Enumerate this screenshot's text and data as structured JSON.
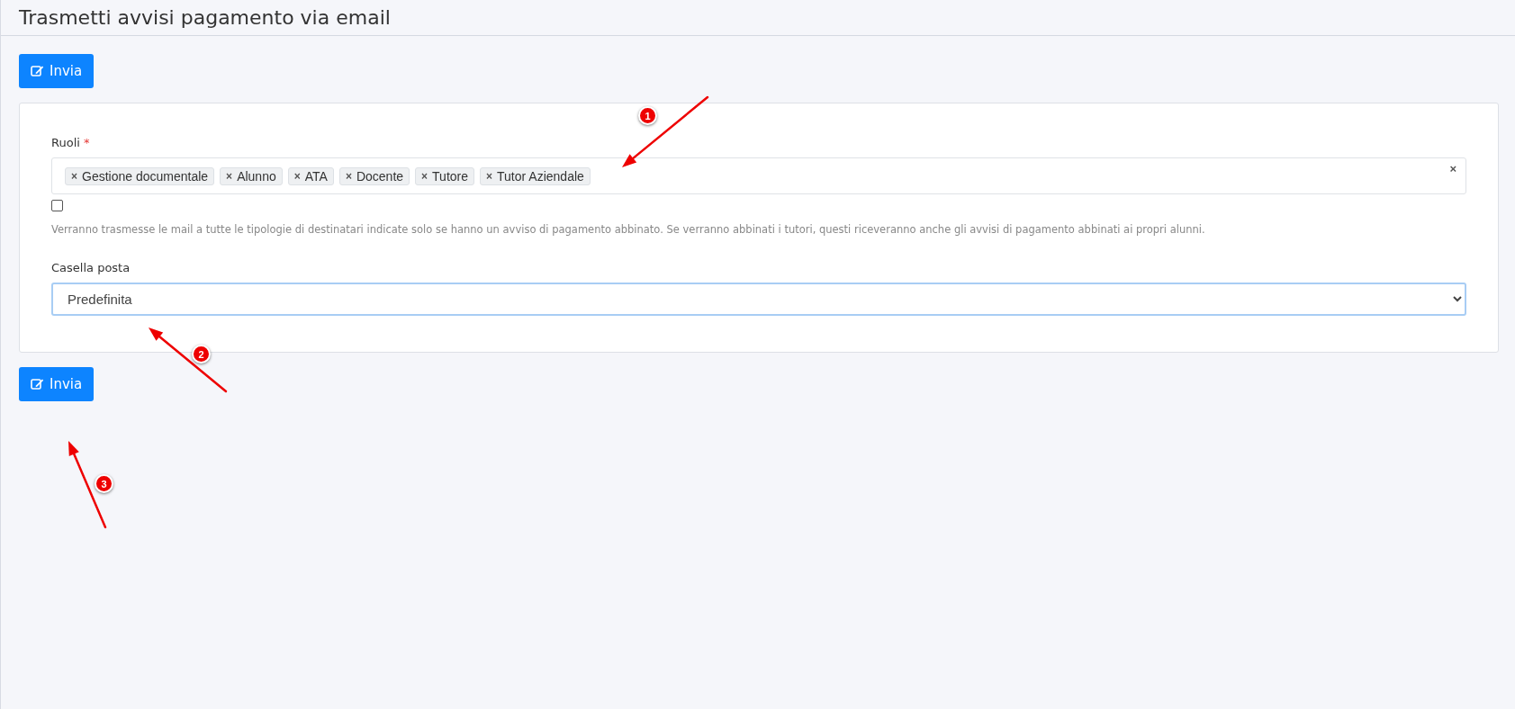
{
  "page_title": "Trasmetti avvisi pagamento via email",
  "top_button": {
    "label": "Invia"
  },
  "form": {
    "roles_field": {
      "label": "Ruoli",
      "required_mark": "*",
      "tags": [
        {
          "remove": "×",
          "label": "Gestione documentale"
        },
        {
          "remove": "×",
          "label": "Alunno"
        },
        {
          "remove": "×",
          "label": "ATA"
        },
        {
          "remove": "×",
          "label": "Docente"
        },
        {
          "remove": "×",
          "label": "Tutore"
        },
        {
          "remove": "×",
          "label": "Tutor Aziendale"
        }
      ],
      "clear": "×",
      "checkbox_checked": false,
      "help": "Verranno trasmesse le mail a tutte le tipologie di destinatari indicate solo se hanno un avviso di pagamento abbinato. Se verranno abbinati i tutori, questi riceveranno anche gli avvisi di pagamento abbinati ai propri alunni."
    },
    "mailbox_field": {
      "label": "Casella posta",
      "value": "Predefinita"
    }
  },
  "bottom_button": {
    "label": "Invia"
  },
  "annotations": [
    {
      "label": "1"
    },
    {
      "label": "2"
    },
    {
      "label": "3"
    }
  ]
}
